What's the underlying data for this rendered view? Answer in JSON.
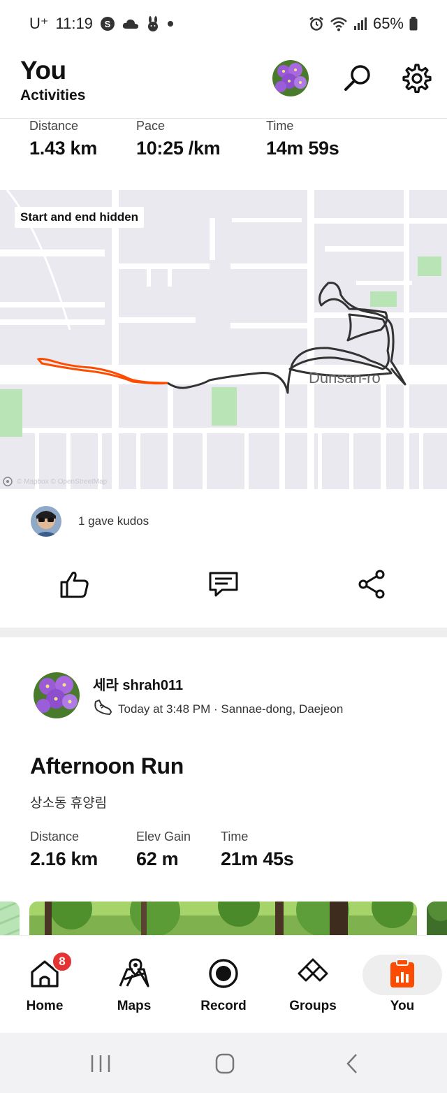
{
  "status_bar": {
    "carrier": "U⁺",
    "time": "11:19",
    "battery": "65%"
  },
  "header": {
    "title": "You",
    "subtitle": "Activities"
  },
  "prev_activity": {
    "stats": [
      {
        "label": "Distance",
        "value": "1.43 km"
      },
      {
        "label": "Pace",
        "value": "10:25 /km"
      },
      {
        "label": "Time",
        "value": "14m 59s"
      }
    ],
    "map": {
      "badge": "Start and end hidden",
      "road_label": "Dunsan-ro",
      "attribution": "© Mapbox © OpenStreetMap"
    },
    "kudos_text": "1 gave kudos"
  },
  "activity": {
    "athlete": "세라 shrah011",
    "meta": "Today at 3:48 PM · Sannae-dong, Daejeon",
    "title": "Afternoon Run",
    "description": "상소동 휴양림",
    "stats": [
      {
        "label": "Distance",
        "value": "2.16 km"
      },
      {
        "label": "Elev Gain",
        "value": "62 m"
      },
      {
        "label": "Time",
        "value": "21m 45s"
      }
    ]
  },
  "bottom_nav": {
    "items": [
      {
        "label": "Home",
        "icon": "home-icon",
        "badge": "8"
      },
      {
        "label": "Maps",
        "icon": "maps-icon"
      },
      {
        "label": "Record",
        "icon": "record-icon"
      },
      {
        "label": "Groups",
        "icon": "groups-icon"
      },
      {
        "label": "You",
        "icon": "you-icon",
        "active": true
      }
    ]
  },
  "colors": {
    "accent": "#fc4c02",
    "route": "#333333",
    "map_bg": "#e9e9ef",
    "badge": "#e53333"
  }
}
